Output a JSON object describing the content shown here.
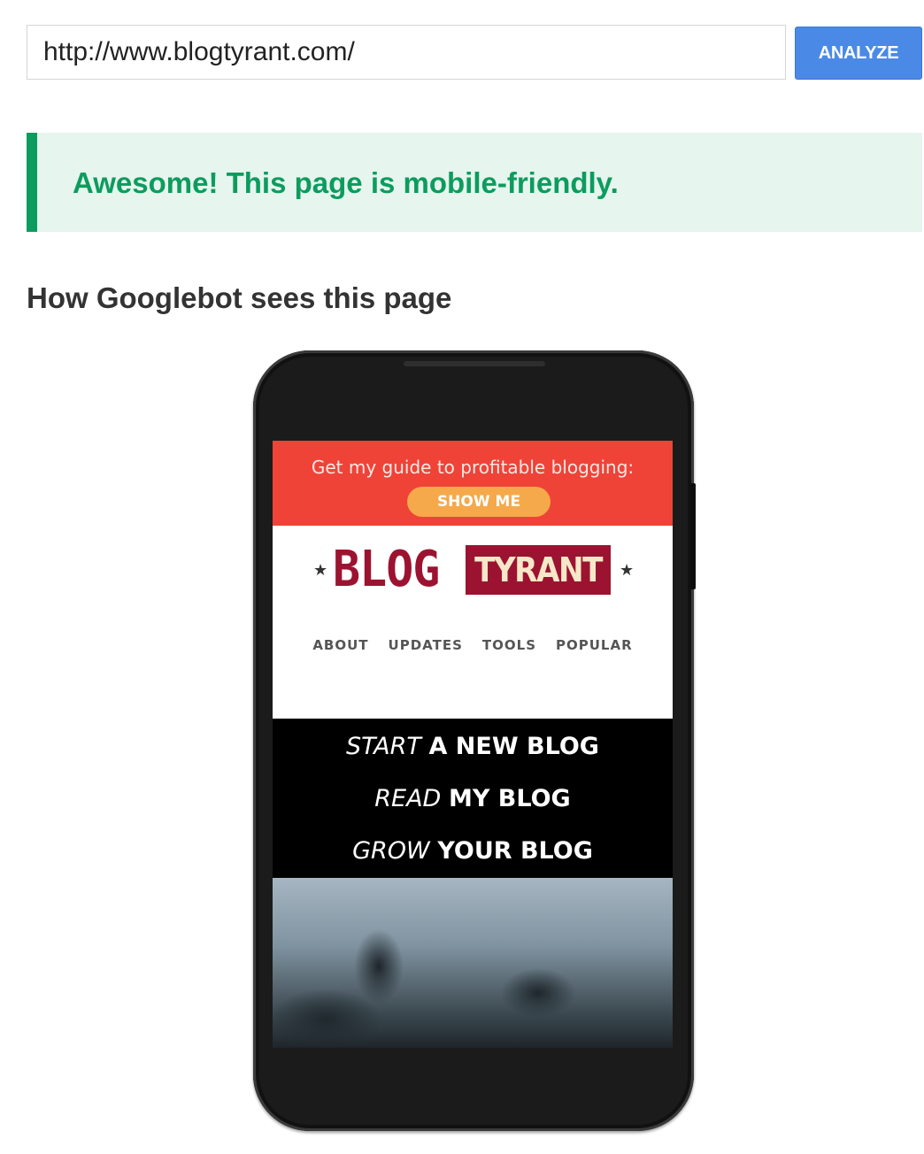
{
  "url_input": {
    "value": "http://www.blogtyrant.com/"
  },
  "analyze_button": {
    "label": "ANALYZE"
  },
  "result": {
    "message": "Awesome! This page is mobile-friendly."
  },
  "preview": {
    "heading": "How Googlebot sees this page"
  },
  "site": {
    "promo_text": "Get my guide to profitable blogging:",
    "promo_button": "SHOW ME",
    "logo_left": "BLOG",
    "logo_right": "TYRANT",
    "nav": [
      "ABOUT",
      "UPDATES",
      "TOOLS",
      "POPULAR"
    ],
    "ctas": [
      {
        "italic": "START",
        "bold": "A NEW BLOG"
      },
      {
        "italic": "READ",
        "bold": "MY BLOG"
      },
      {
        "italic": "GROW",
        "bold": "YOUR BLOG"
      }
    ]
  },
  "colors": {
    "analyze_button": "#4a8ae6",
    "success_green": "#0c9c5e",
    "success_bg": "#e6f5ee",
    "promo_red": "#ef4338",
    "promo_button": "#f6a94a",
    "logo_red": "#9c1331"
  }
}
